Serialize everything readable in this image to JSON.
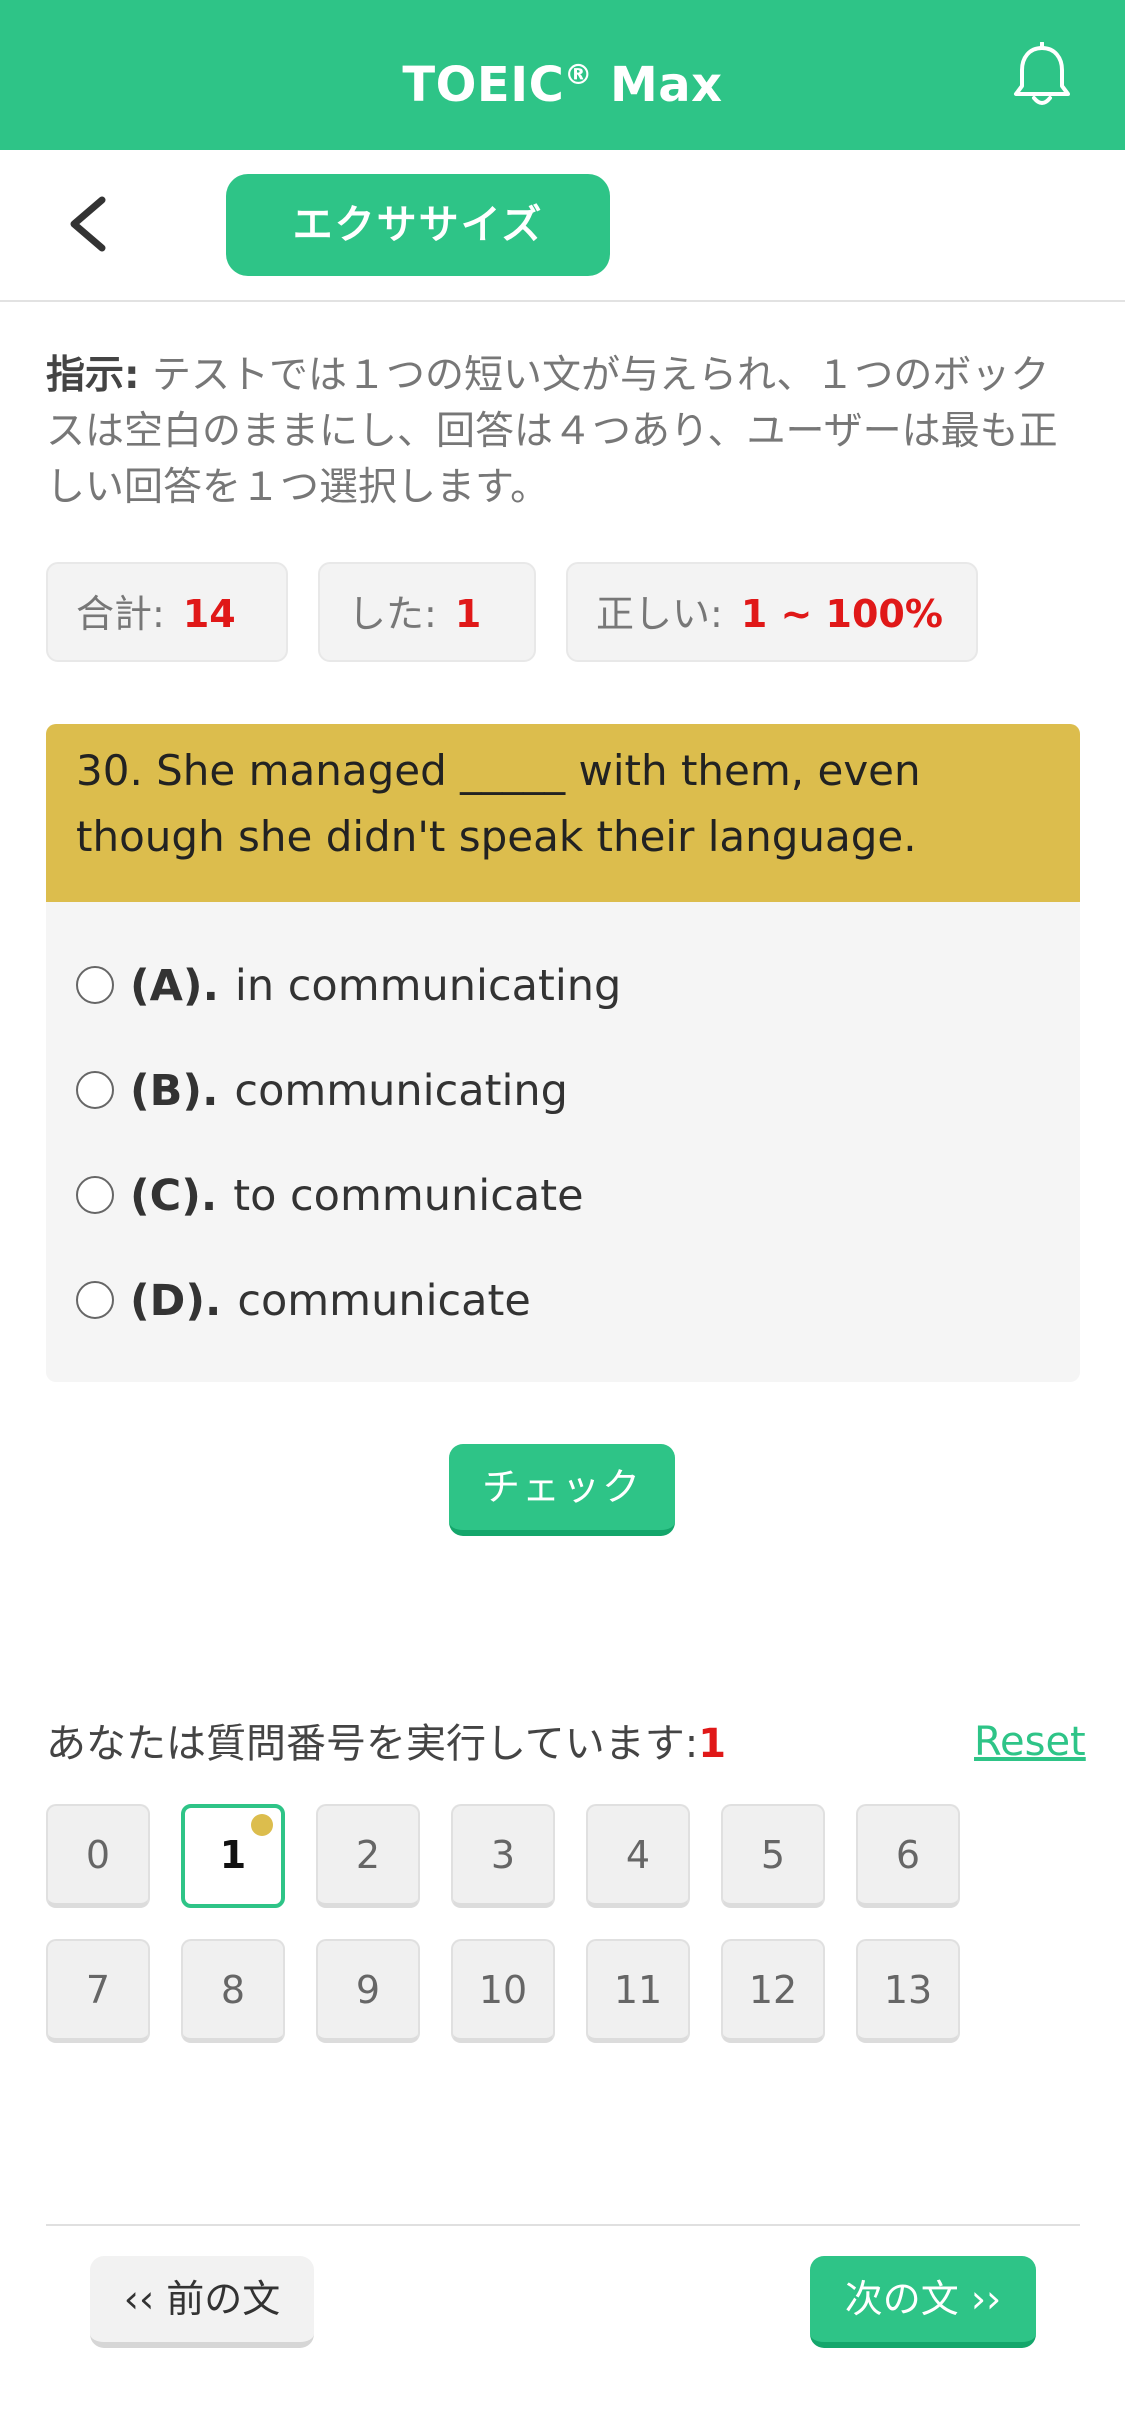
{
  "header": {
    "title": "TOEIC",
    "title_mark": "®",
    "title_suffix": " Max",
    "bell_icon": "bell-icon"
  },
  "subheader": {
    "back_icon": "chevron-left-icon",
    "tab_label": "エクササイズ"
  },
  "instructions": {
    "label": "指示:",
    "text": " テストでは１つの短い文が与えられ、１つのボックスは空白のままにし、回答は４つあり、ユーザーは最も正しい回答を１つ選択します。"
  },
  "stats": {
    "total_label": "合計:",
    "total_value": "14",
    "done_label": "した:",
    "done_value": "1",
    "correct_label": "正しい:",
    "correct_value": "1 ~ 100%"
  },
  "question": {
    "text": "30. She managed _____ with them, even though she didn't speak their language.",
    "options": [
      {
        "letter": "(A).",
        "text": "in communicating"
      },
      {
        "letter": "(B).",
        "text": "communicating"
      },
      {
        "letter": "(C).",
        "text": "to communicate"
      },
      {
        "letter": "(D).",
        "text": "communicate"
      }
    ]
  },
  "check_label": "チェック",
  "progress": {
    "label": "あなたは質問番号を実行しています:",
    "current": "1",
    "reset_label": "Reset",
    "numbers": [
      "0",
      "1",
      "2",
      "3",
      "4",
      "5",
      "6",
      "7",
      "8",
      "9",
      "10",
      "11",
      "12",
      "13"
    ],
    "active_index": 1
  },
  "nav": {
    "prev_label": "‹‹ 前の文",
    "next_label": "次の文 ››"
  },
  "colors": {
    "brand": "#2ec487",
    "question_header": "#dcbd4d",
    "accent_red": "#e01818"
  }
}
